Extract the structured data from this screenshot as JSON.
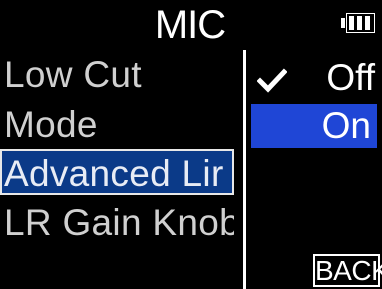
{
  "header": {
    "title": "MIC",
    "battery_icon": "battery-icon",
    "battery_level": 1.0
  },
  "menu": {
    "items": [
      {
        "label": "Low Cut",
        "selected": false
      },
      {
        "label": "Mode",
        "selected": false
      },
      {
        "label": "Advanced Lir",
        "selected": true
      },
      {
        "label": "LR Gain Knob",
        "selected": false
      }
    ]
  },
  "options": {
    "items": [
      {
        "label": "Off",
        "checked": true,
        "highlighted": false
      },
      {
        "label": "On",
        "checked": false,
        "highlighted": true
      }
    ],
    "check_icon": "checkmark-icon",
    "highlight_color": "#1f46d6"
  },
  "footer": {
    "back_label": "BACK"
  },
  "colors": {
    "background": "#000000",
    "menu_selection": "#0b3a88",
    "option_highlight": "#1f46d6"
  }
}
